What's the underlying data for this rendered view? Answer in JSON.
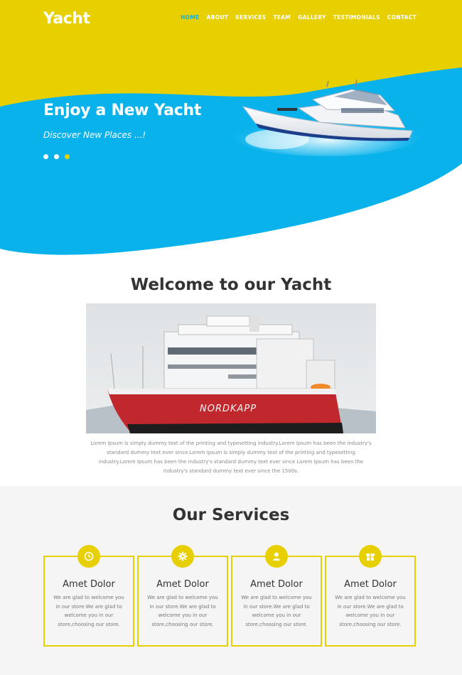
{
  "header": {
    "logo": "Yacht",
    "nav": [
      {
        "label": "HOME",
        "active": true
      },
      {
        "label": "ABOUT"
      },
      {
        "label": "SERVICES"
      },
      {
        "label": "TEAM"
      },
      {
        "label": "GALLERY"
      },
      {
        "label": "TESTIMONIALS"
      },
      {
        "label": "CONTACT"
      }
    ]
  },
  "hero": {
    "title": "Enjoy a New Yacht",
    "subtitle": "Discover New Places ...!",
    "slide_count": 3,
    "active_slide": 3
  },
  "welcome": {
    "title": "Welcome to our Yacht",
    "ship_name": "NORDKAPP",
    "paragraph": "Lorem Ipsum is simply dummy text of the printing and typesetting industry.Lorem Ipsum has been the industry's standard dummy text ever since.Lorem Ipsum is simply dummy text of the printing and typesetting industry.Lorem Ipsum has been the industry's standard dummy text ever since Lorem Ipsum has been the industry's standard dummy text ever since the 1500s."
  },
  "services": {
    "title": "Our Services",
    "items": [
      {
        "icon": "clock-icon",
        "title": "Amet Dolor",
        "text": "We are glad to welcome you in our store.We are glad to welcome you in our store,choosing our store."
      },
      {
        "icon": "gear-icon",
        "title": "Amet Dolor",
        "text": "We are glad to welcome you in our store.We are glad to welcome you in our store,choosing our store."
      },
      {
        "icon": "user-icon",
        "title": "Amet Dolor",
        "text": "We are glad to welcome you in our store.We are glad to welcome you in our store,choosing our store."
      },
      {
        "icon": "gift-icon",
        "title": "Amet Dolor",
        "text": "We are glad to welcome you in our store.We are glad to welcome you in our store,choosing our store."
      }
    ]
  },
  "colors": {
    "accent_yellow": "#e8cf00",
    "sky_blue": "#0ab2ec",
    "active_nav": "#0ab2ec"
  }
}
